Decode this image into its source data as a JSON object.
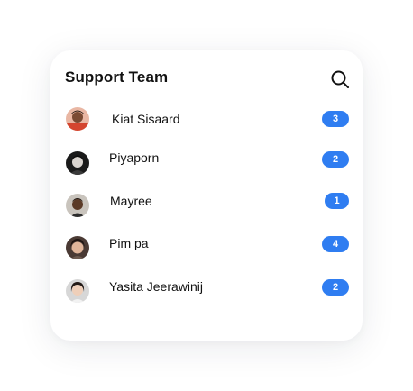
{
  "header": {
    "title": "Support Team"
  },
  "members": [
    {
      "name": "Kiat Sisaard",
      "count": "3"
    },
    {
      "name": "Piyaporn",
      "count": "2"
    },
    {
      "name": "Mayree",
      "count": "1"
    },
    {
      "name": "Pim pa",
      "count": "4"
    },
    {
      "name": "Yasita Jeerawinij",
      "count": "2"
    }
  ],
  "icons": {
    "search": "search-icon"
  },
  "colors": {
    "badge": "#2f7df1",
    "text": "#111111",
    "card": "#ffffff"
  }
}
